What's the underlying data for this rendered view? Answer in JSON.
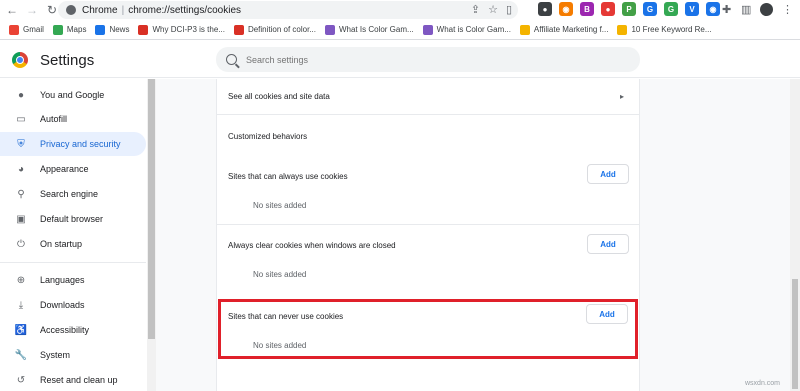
{
  "browser": {
    "host": "Chrome",
    "url": "chrome://settings/cookies",
    "bookmarks": [
      {
        "label": "Gmail",
        "color": "#ea4335"
      },
      {
        "label": "Maps",
        "color": "#34a853"
      },
      {
        "label": "News",
        "color": "#1a73e8"
      },
      {
        "label": "Why DCI-P3 is the...",
        "color": "#d93025"
      },
      {
        "label": "Definition of color...",
        "color": "#d93025"
      },
      {
        "label": "What Is Color Gam...",
        "color": "#7e57c2"
      },
      {
        "label": "What is Color Gam...",
        "color": "#7e57c2"
      },
      {
        "label": "Affiliate Marketing f...",
        "color": "#f4b400"
      },
      {
        "label": "10 Free Keyword Re...",
        "color": "#f4b400"
      }
    ],
    "extensions": [
      {
        "name": "ext-icon-1",
        "color": "#3c4043",
        "glyph": "●"
      },
      {
        "name": "ext-icon-2",
        "color": "#f57c00",
        "glyph": "◉"
      },
      {
        "name": "ext-icon-3",
        "color": "#9c27b0",
        "glyph": "B"
      },
      {
        "name": "ext-icon-4",
        "color": "#e53935",
        "glyph": "●"
      },
      {
        "name": "ext-icon-5",
        "color": "#43a047",
        "glyph": "P"
      },
      {
        "name": "ext-icon-6",
        "color": "#1a73e8",
        "glyph": "G"
      },
      {
        "name": "ext-icon-7",
        "color": "#34a853",
        "glyph": "G"
      },
      {
        "name": "ext-icon-8",
        "color": "#1a73e8",
        "glyph": "V"
      },
      {
        "name": "ext-icon-9",
        "color": "#1a73e8",
        "glyph": "◉"
      }
    ]
  },
  "settings": {
    "title": "Settings",
    "search_placeholder": "Search settings"
  },
  "sidebar": {
    "items": [
      {
        "label": "You and Google",
        "icon": "person-icon",
        "glyph": "●"
      },
      {
        "label": "Autofill",
        "icon": "autofill-icon",
        "glyph": "▭"
      },
      {
        "label": "Privacy and security",
        "icon": "shield-icon",
        "glyph": "⛨",
        "active": true
      },
      {
        "label": "Appearance",
        "icon": "palette-icon",
        "glyph": "◕"
      },
      {
        "label": "Search engine",
        "icon": "search-icon",
        "glyph": "⚲"
      },
      {
        "label": "Default browser",
        "icon": "browser-icon",
        "glyph": "▣"
      },
      {
        "label": "On startup",
        "icon": "power-icon",
        "glyph": "⏻"
      },
      {
        "label": "Languages",
        "icon": "globe-icon",
        "glyph": "⊕"
      },
      {
        "label": "Downloads",
        "icon": "download-icon",
        "glyph": "⤓"
      },
      {
        "label": "Accessibility",
        "icon": "accessibility-icon",
        "glyph": "♿"
      },
      {
        "label": "System",
        "icon": "wrench-icon",
        "glyph": "🔧"
      },
      {
        "label": "Reset and clean up",
        "icon": "reset-icon",
        "glyph": "↺"
      }
    ]
  },
  "main": {
    "see_all": "See all cookies and site data",
    "customized_heading": "Customized behaviors",
    "sections": [
      {
        "label": "Sites that can always use cookies",
        "add_label": "Add",
        "empty": "No sites added"
      },
      {
        "label": "Always clear cookies when windows are closed",
        "add_label": "Add",
        "empty": "No sites added"
      },
      {
        "label": "Sites that can never use cookies",
        "add_label": "Add",
        "empty": "No sites added"
      }
    ]
  },
  "watermark": "wsxdn.com",
  "colors": {
    "accent": "#1a73e8",
    "highlight": "#e0202a",
    "active_bg": "#e8f0fe"
  }
}
